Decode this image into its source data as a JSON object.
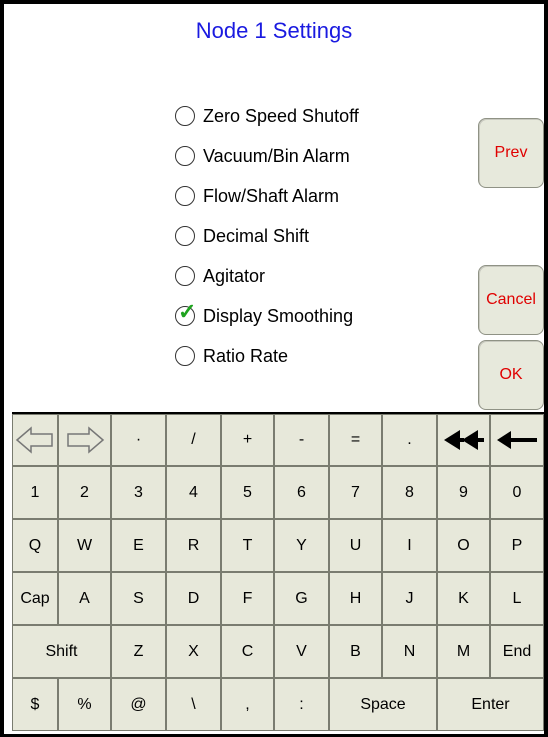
{
  "title": "Node 1 Settings",
  "options": [
    {
      "label": "Zero Speed Shutoff",
      "checked": false
    },
    {
      "label": "Vacuum/Bin Alarm",
      "checked": false
    },
    {
      "label": "Flow/Shaft Alarm",
      "checked": false
    },
    {
      "label": "Decimal Shift",
      "checked": false
    },
    {
      "label": "Agitator",
      "checked": false
    },
    {
      "label": "Display Smoothing",
      "checked": true
    },
    {
      "label": "Ratio Rate",
      "checked": false
    }
  ],
  "buttons": {
    "prev": "Prev",
    "cancel": "Cancel",
    "ok": "OK"
  },
  "keyboard": {
    "row1": [
      "⇦",
      "⇨",
      "·",
      "/",
      "+",
      "-",
      "=",
      ".",
      "◀◀",
      "⟵"
    ],
    "row2": [
      "1",
      "2",
      "3",
      "4",
      "5",
      "6",
      "7",
      "8",
      "9",
      "0"
    ],
    "row3": [
      "Q",
      "W",
      "E",
      "R",
      "T",
      "Y",
      "U",
      "I",
      "O",
      "P"
    ],
    "row4": [
      "Cap",
      "A",
      "S",
      "D",
      "F",
      "G",
      "H",
      "J",
      "K",
      "L"
    ],
    "row5": [
      "Shift",
      "Z",
      "X",
      "C",
      "V",
      "B",
      "N",
      "M",
      "End"
    ],
    "row6": [
      "$",
      "%",
      "@",
      "\\",
      ",",
      ":",
      "Space",
      "Enter"
    ]
  }
}
